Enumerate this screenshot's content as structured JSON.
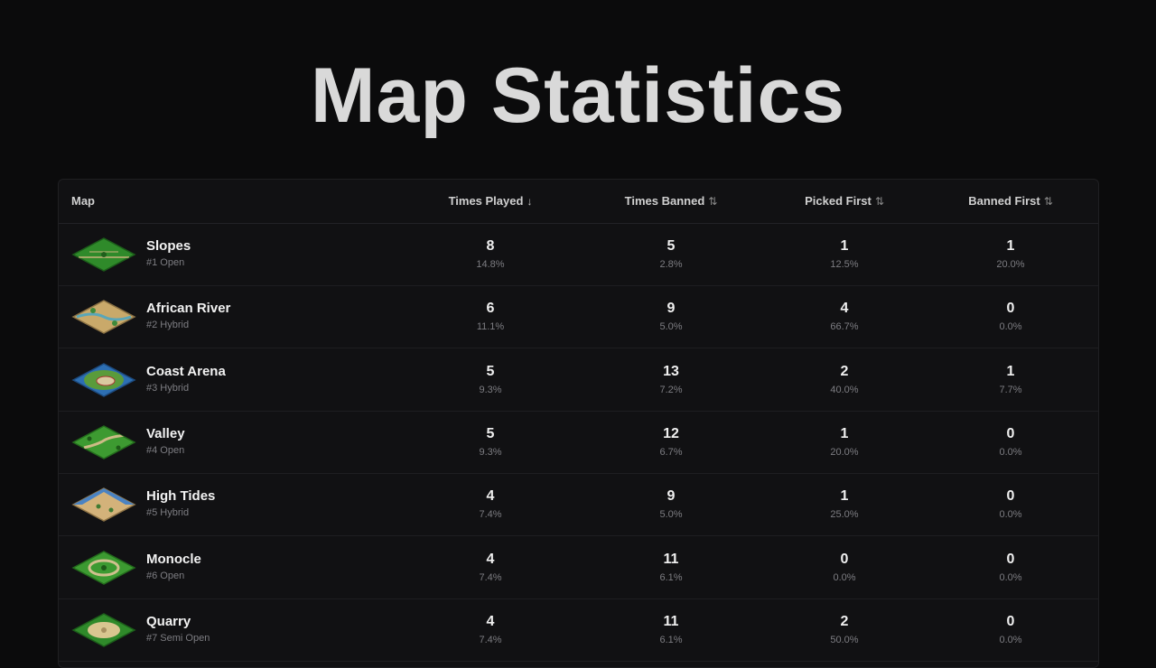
{
  "page": {
    "title": "Map Statistics"
  },
  "table": {
    "headers": {
      "map": "Map",
      "times_played": "Times Played",
      "times_banned": "Times Banned",
      "picked_first": "Picked First",
      "banned_first": "Banned First"
    },
    "sort": {
      "active_column": "times_played",
      "direction": "descending"
    },
    "icons": {
      "sort_active": "arrow-down-icon",
      "sort_inactive": "sort-arrows-icon"
    },
    "rows": [
      {
        "name": "Slopes",
        "sub": "#1 Open",
        "thumb": "slopes",
        "played": "8",
        "played_pct": "14.8%",
        "banned": "5",
        "banned_pct": "2.8%",
        "picked_first": "1",
        "picked_first_pct": "12.5%",
        "banned_first": "1",
        "banned_first_pct": "20.0%"
      },
      {
        "name": "African River",
        "sub": "#2 Hybrid",
        "thumb": "african-river",
        "played": "6",
        "played_pct": "11.1%",
        "banned": "9",
        "banned_pct": "5.0%",
        "picked_first": "4",
        "picked_first_pct": "66.7%",
        "banned_first": "0",
        "banned_first_pct": "0.0%"
      },
      {
        "name": "Coast Arena",
        "sub": "#3 Hybrid",
        "thumb": "coast-arena",
        "played": "5",
        "played_pct": "9.3%",
        "banned": "13",
        "banned_pct": "7.2%",
        "picked_first": "2",
        "picked_first_pct": "40.0%",
        "banned_first": "1",
        "banned_first_pct": "7.7%"
      },
      {
        "name": "Valley",
        "sub": "#4 Open",
        "thumb": "valley",
        "played": "5",
        "played_pct": "9.3%",
        "banned": "12",
        "banned_pct": "6.7%",
        "picked_first": "1",
        "picked_first_pct": "20.0%",
        "banned_first": "0",
        "banned_first_pct": "0.0%"
      },
      {
        "name": "High Tides",
        "sub": "#5 Hybrid",
        "thumb": "high-tides",
        "played": "4",
        "played_pct": "7.4%",
        "banned": "9",
        "banned_pct": "5.0%",
        "picked_first": "1",
        "picked_first_pct": "25.0%",
        "banned_first": "0",
        "banned_first_pct": "0.0%"
      },
      {
        "name": "Monocle",
        "sub": "#6 Open",
        "thumb": "monocle",
        "played": "4",
        "played_pct": "7.4%",
        "banned": "11",
        "banned_pct": "6.1%",
        "picked_first": "0",
        "picked_first_pct": "0.0%",
        "banned_first": "0",
        "banned_first_pct": "0.0%"
      },
      {
        "name": "Quarry",
        "sub": "#7 Semi Open",
        "thumb": "quarry",
        "played": "4",
        "played_pct": "7.4%",
        "banned": "11",
        "banned_pct": "6.1%",
        "picked_first": "2",
        "picked_first_pct": "50.0%",
        "banned_first": "0",
        "banned_first_pct": "0.0%"
      }
    ]
  },
  "colors": {
    "background": "#0b0b0c",
    "card": "#111113",
    "text": "#f0f0f0",
    "muted": "#7d7d82"
  }
}
